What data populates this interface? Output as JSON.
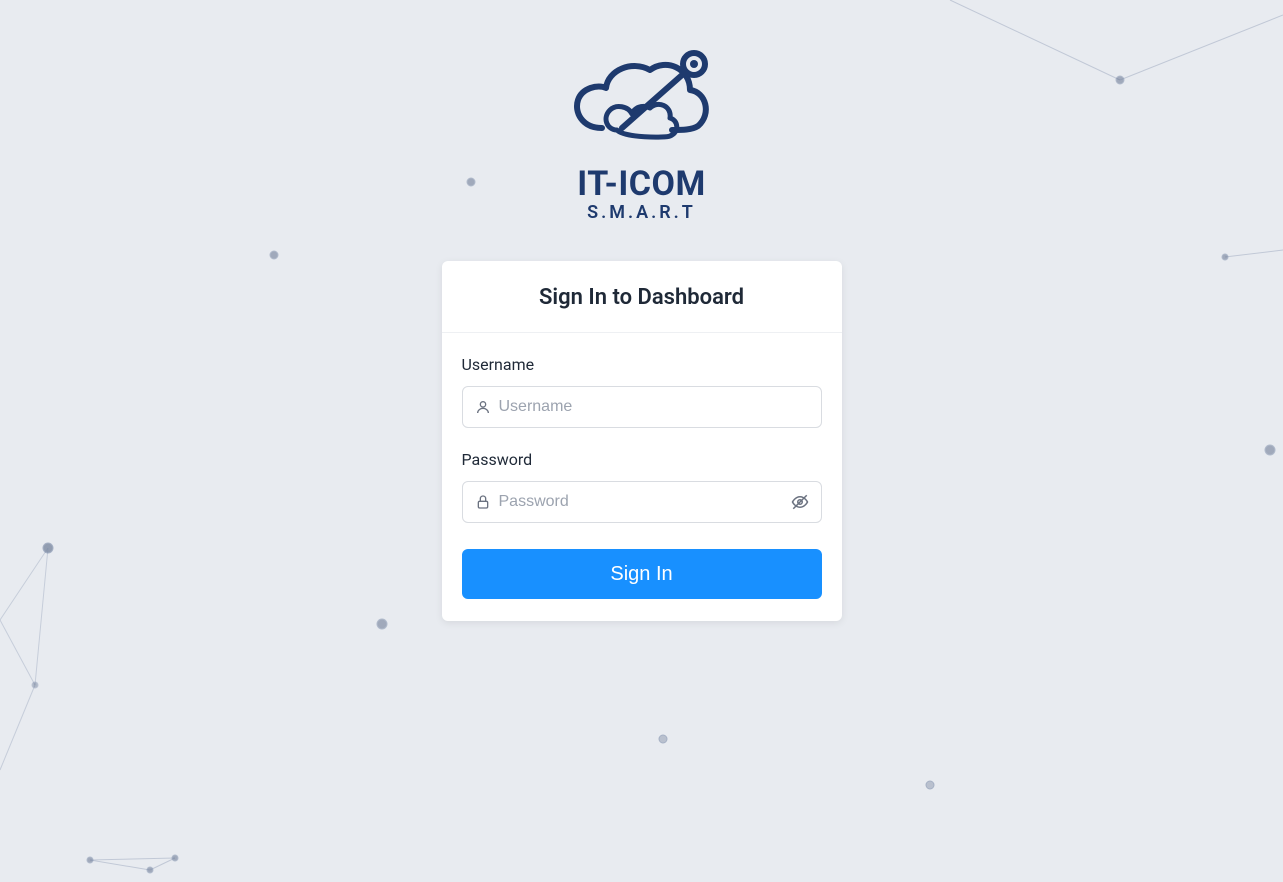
{
  "logo": {
    "title": "IT-ICOM",
    "subtitle": "S.M.A.R.T"
  },
  "card": {
    "title": "Sign In to Dashboard"
  },
  "form": {
    "username_label": "Username",
    "username_placeholder": "Username",
    "password_label": "Password",
    "password_placeholder": "Password",
    "signin_label": "Sign In"
  }
}
